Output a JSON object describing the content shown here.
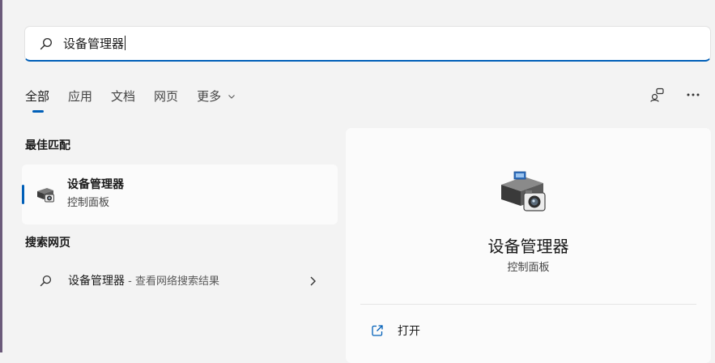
{
  "search": {
    "query": "设备管理器",
    "icon": "search-icon"
  },
  "tabs": [
    {
      "label": "全部",
      "active": true
    },
    {
      "label": "应用"
    },
    {
      "label": "文档"
    },
    {
      "label": "网页"
    },
    {
      "label": "更多",
      "has_dropdown": true
    }
  ],
  "toolbar": {
    "share_icon": "share-devices-icon",
    "more_icon": "more-options-icon",
    "more_label": "···"
  },
  "best_match": {
    "heading": "最佳匹配",
    "item": {
      "title": "设备管理器",
      "subtitle": "控制面板",
      "icon": "device-manager-icon"
    }
  },
  "web_search": {
    "heading": "搜索网页",
    "item": {
      "query": "设备管理器",
      "hint": " - 查看网络搜索结果",
      "icon": "search-icon"
    }
  },
  "detail": {
    "title": "设备管理器",
    "subtitle": "控制面板",
    "icon": "device-manager-icon",
    "actions": [
      {
        "label": "打开",
        "icon": "open-external-icon"
      }
    ]
  },
  "colors": {
    "accent": "#005fb8",
    "background": "#f3f3f3",
    "card": "#fbfbfb"
  }
}
